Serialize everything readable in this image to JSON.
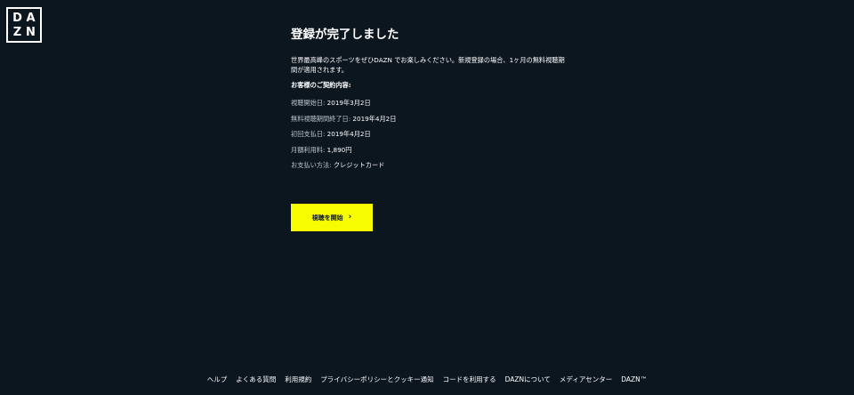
{
  "logo": {
    "letters": [
      "D",
      "A",
      "Z",
      "N"
    ]
  },
  "main": {
    "title": "登録が完了しました",
    "description": "世界最高峰のスポーツをぜひDAZN でお楽しみください。新規登録の場合、1ヶ月の無料視聴期間が適用されます。",
    "contract_heading": "お客様のご契約内容:",
    "details": [
      {
        "label": "視聴開始日:",
        "value": "2019年3月2日"
      },
      {
        "label": "無料視聴期間終了日:",
        "value": "2019年4月2日"
      },
      {
        "label": "初回支払日:",
        "value": "2019年4月2日"
      },
      {
        "label": "月額利用料:",
        "value": "1,890円"
      },
      {
        "label": "お支払い方法:",
        "value": "クレジットカード"
      }
    ],
    "cta_label": "視聴を開始",
    "cta_chevron": "›"
  },
  "footer": {
    "links": [
      "ヘルプ",
      "よくある質問",
      "利用規約",
      "プライバシーポリシーとクッキー通知",
      "コードを利用する",
      "DAZNについて",
      "メディアセンター",
      "DAZN™"
    ]
  },
  "colors": {
    "background": "#0c161f",
    "accent": "#f8fc00",
    "text": "#ffffff"
  }
}
